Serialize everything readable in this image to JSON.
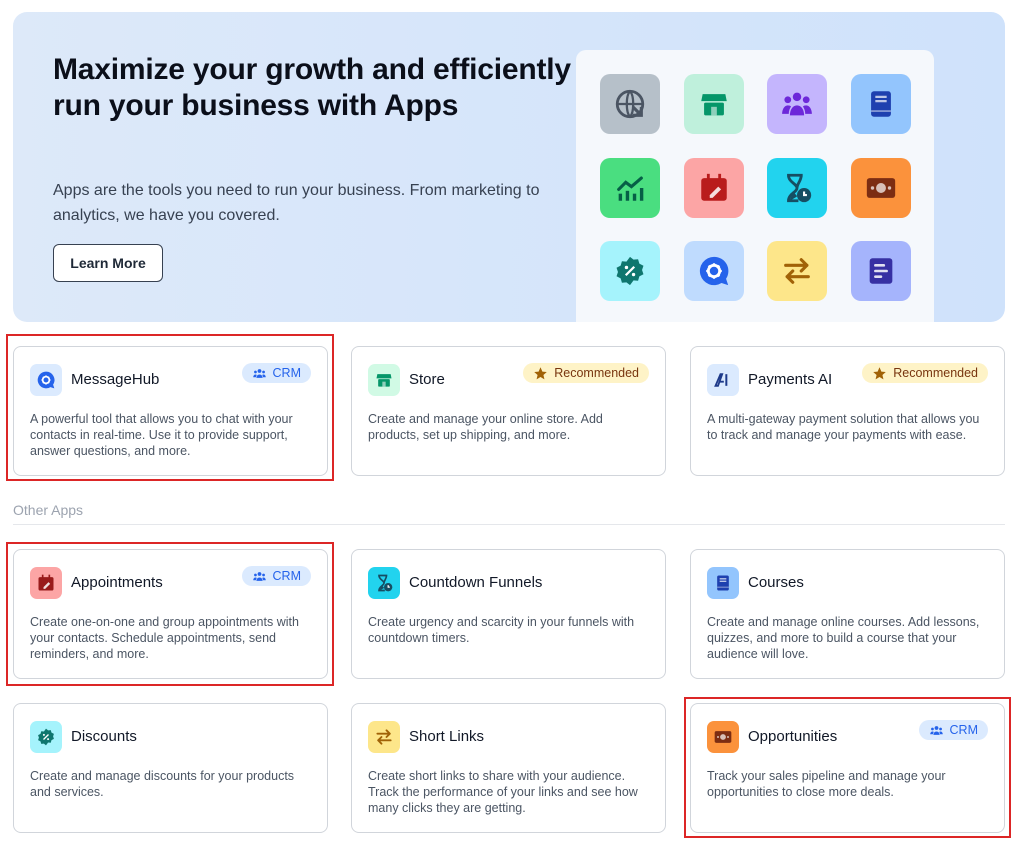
{
  "hero": {
    "title": "Maximize your growth and efficiently run your business with Apps",
    "description": "Apps are the tools you need to run your business. From marketing to analytics, we have you covered.",
    "button_label": "Learn More",
    "icons": [
      {
        "name": "globe-arrow-icon",
        "bg": "#b6c0c9",
        "fg": "#4b5563"
      },
      {
        "name": "store-icon",
        "bg": "#bff0dc",
        "fg": "#059669"
      },
      {
        "name": "people-group-icon",
        "bg": "#c4b5fd",
        "fg": "#6d28d9"
      },
      {
        "name": "book-icon",
        "bg": "#93c5fd",
        "fg": "#1e40af"
      },
      {
        "name": "chart-trend-icon",
        "bg": "#4ade80",
        "fg": "#065f46"
      },
      {
        "name": "calendar-edit-icon",
        "bg": "#fca5a5",
        "fg": "#b91c1c"
      },
      {
        "name": "hourglass-clock-icon",
        "bg": "#22d3ee",
        "fg": "#164e63"
      },
      {
        "name": "money-bill-icon",
        "bg": "#fb923c",
        "fg": "#7c2d12"
      },
      {
        "name": "discount-badge-icon",
        "bg": "#a5f3fc",
        "fg": "#0f766e"
      },
      {
        "name": "message-gear-icon",
        "bg": "#bfdbfe",
        "fg": "#2563eb"
      },
      {
        "name": "swap-arrows-icon",
        "bg": "#fde68a",
        "fg": "#a16207"
      },
      {
        "name": "document-lines-icon",
        "bg": "#a5b4fc",
        "fg": "#3730a3"
      }
    ]
  },
  "featured": [
    {
      "name": "MessageHub",
      "icon": "message-gear-icon",
      "icon_bg": "#dbeafe",
      "icon_fg": "#2563eb",
      "badge": "CRM",
      "badge_type": "crm",
      "description": "A powerful tool that allows you to chat with your contacts in real-time. Use it to provide support, answer questions, and more."
    },
    {
      "name": "Store",
      "icon": "store-icon",
      "icon_bg": "#d1fae5",
      "icon_fg": "#059669",
      "badge": "Recommended",
      "badge_type": "rec",
      "description": "Create and manage your online store. Add products, set up shipping, and more."
    },
    {
      "name": "Payments AI",
      "icon": "ai-logo-icon",
      "icon_bg": "#dbeafe",
      "icon_fg": "#1e3a8a",
      "badge": "Recommended",
      "badge_type": "rec",
      "description": "A multi-gateway payment solution that allows you to track and manage your payments with ease."
    }
  ],
  "other_apps_label": "Other Apps",
  "other": [
    {
      "name": "Appointments",
      "icon": "calendar-edit-icon",
      "icon_bg": "#fca5a5",
      "icon_fg": "#991b1b",
      "badge": "CRM",
      "badge_type": "crm",
      "description": "Create one-on-one and group appointments with your contacts. Schedule appointments, send reminders, and more."
    },
    {
      "name": "Countdown Funnels",
      "icon": "hourglass-clock-icon",
      "icon_bg": "#22d3ee",
      "icon_fg": "#164e63",
      "badge": "",
      "badge_type": "",
      "description": "Create urgency and scarcity in your funnels with countdown timers."
    },
    {
      "name": "Courses",
      "icon": "book-icon",
      "icon_bg": "#93c5fd",
      "icon_fg": "#1e40af",
      "badge": "",
      "badge_type": "",
      "description": "Create and manage online courses. Add lessons, quizzes, and more to build a course that your audience will love."
    },
    {
      "name": "Discounts",
      "icon": "discount-badge-icon",
      "icon_bg": "#a5f3fc",
      "icon_fg": "#0f766e",
      "badge": "",
      "badge_type": "",
      "description": "Create and manage discounts for your products and services."
    },
    {
      "name": "Short Links",
      "icon": "swap-arrows-icon",
      "icon_bg": "#fde68a",
      "icon_fg": "#a16207",
      "badge": "",
      "badge_type": "",
      "description": "Create short links to share with your audience. Track the performance of your links and see how many clicks they are getting."
    },
    {
      "name": "Opportunities",
      "icon": "money-bill-icon",
      "icon_bg": "#fb923c",
      "icon_fg": "#7c2d12",
      "badge": "CRM",
      "badge_type": "crm",
      "description": "Track your sales pipeline and manage your opportunities to close more deals."
    }
  ]
}
